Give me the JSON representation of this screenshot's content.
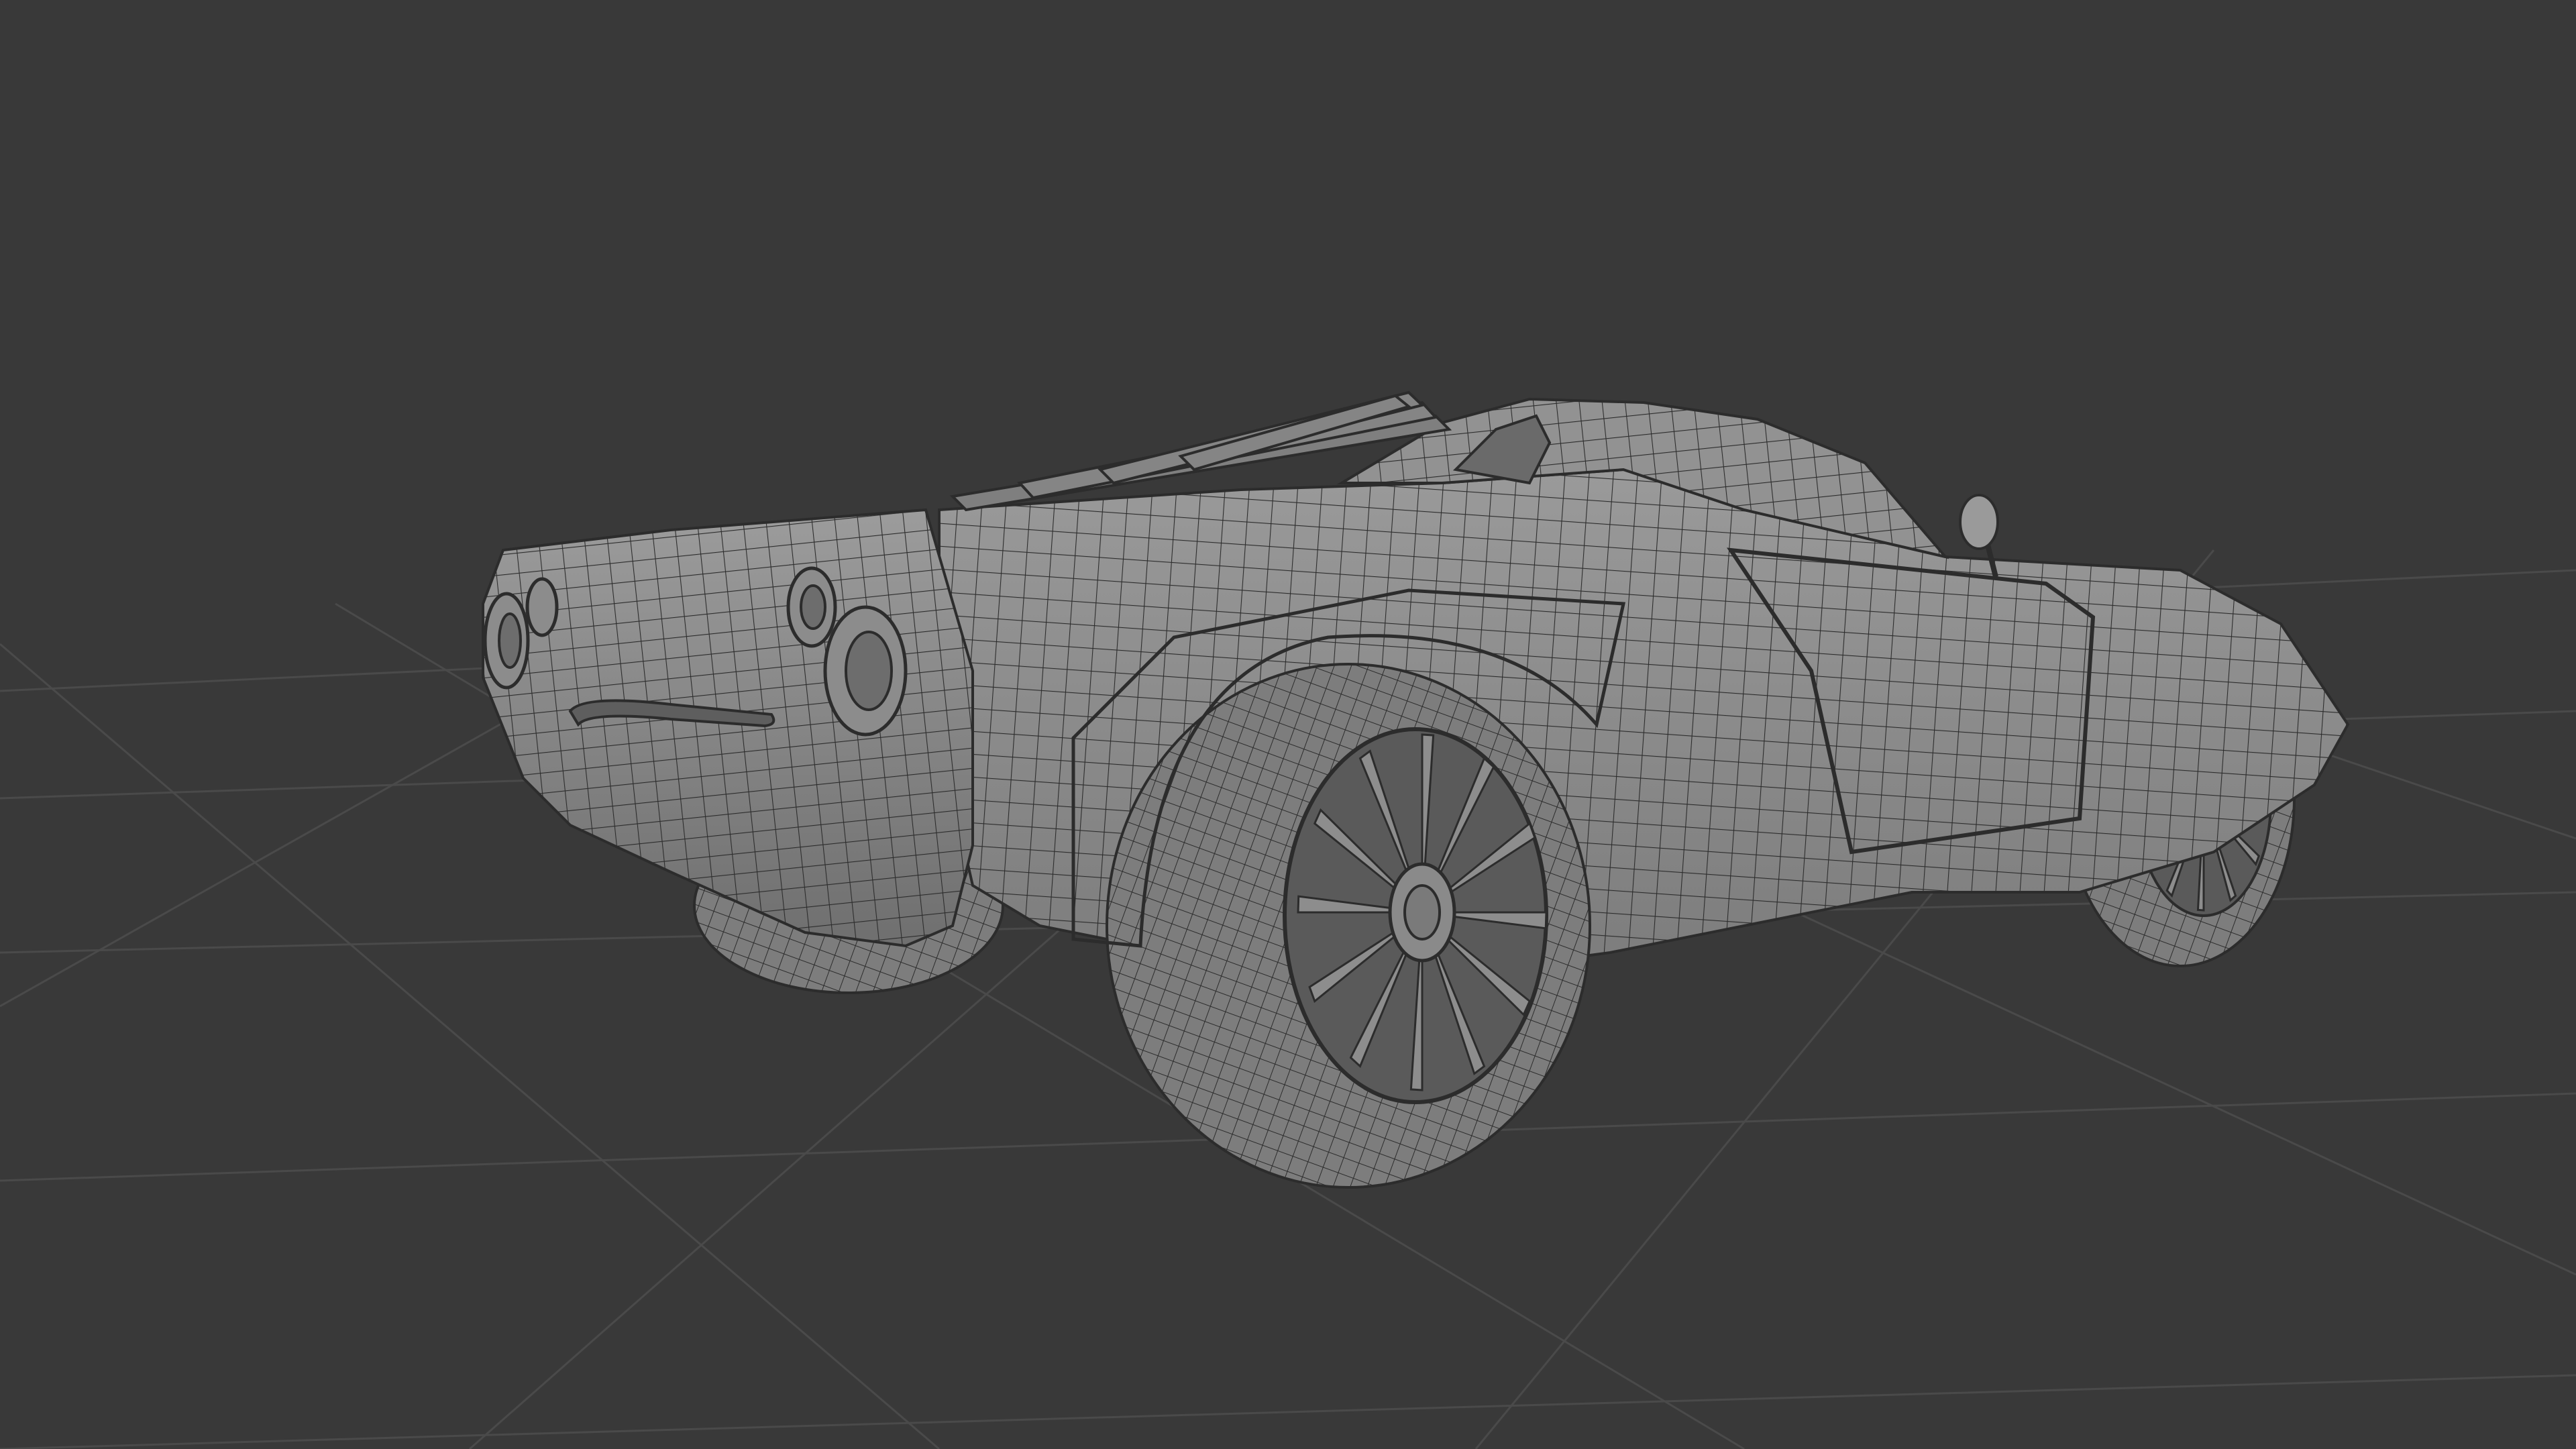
{
  "viewport": {
    "background_color": "#393939",
    "grid_color": "#4a4a4a",
    "mesh_fill_color": "#8a8a8a",
    "mesh_shadow_color": "#6e6e6e",
    "mesh_highlight_color": "#a2a2a2",
    "wireframe_color": "#2c2c2c",
    "tire_color": "#7c7c7c"
  },
  "scene": {
    "object": "car-mesh",
    "display_mode": "wireframe-over-solid",
    "grid": true,
    "wheels_visible": 3,
    "spokes_per_wheel": 12
  }
}
